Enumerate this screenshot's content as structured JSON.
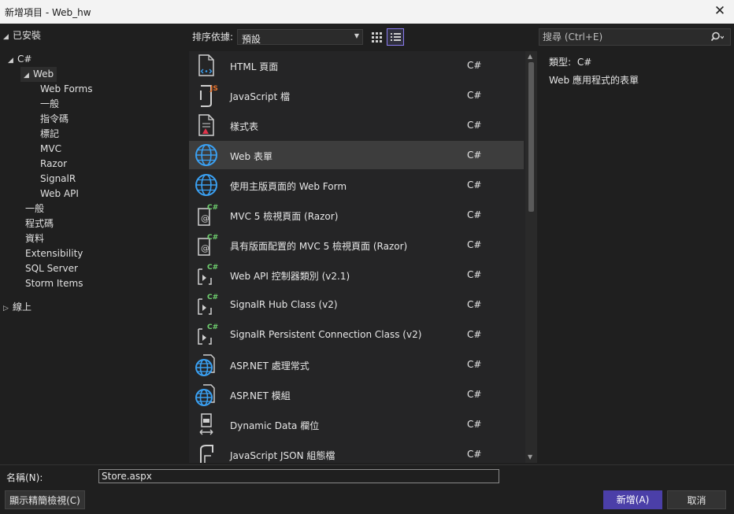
{
  "window": {
    "title": "新增項目 - Web_hw",
    "close_glyph": "✕"
  },
  "tree": {
    "installed": "已安裝",
    "csharp": "C#",
    "web": "Web",
    "web_children": [
      "Web Forms",
      "一般",
      "指令碼",
      "標記",
      "MVC",
      "Razor",
      "SignalR",
      "Web API"
    ],
    "csharp_children": [
      "一般",
      "程式碼",
      "資料",
      "Extensibility",
      "SQL Server",
      "Storm Items"
    ],
    "online": "線上",
    "selected": "Web"
  },
  "toolbar": {
    "sort_label": "排序依據:",
    "sort_value": "預設",
    "view_mode": "list"
  },
  "search": {
    "placeholder": "搜尋 (Ctrl+E)"
  },
  "items": [
    {
      "name": "HTML 頁面",
      "lang": "C#",
      "icon": "html-page-icon"
    },
    {
      "name": "JavaScript 檔",
      "lang": "C#",
      "icon": "javascript-file-icon"
    },
    {
      "name": "樣式表",
      "lang": "C#",
      "icon": "stylesheet-icon"
    },
    {
      "name": "Web 表單",
      "lang": "C#",
      "icon": "web-form-globe-icon"
    },
    {
      "name": "使用主版頁面的 Web Form",
      "lang": "C#",
      "icon": "web-form-globe-icon"
    },
    {
      "name": "MVC 5 檢視頁面 (Razor)",
      "lang": "C#",
      "icon": "razor-view-icon"
    },
    {
      "name": "具有版面配置的 MVC 5 檢視頁面 (Razor)",
      "lang": "C#",
      "icon": "razor-view-icon"
    },
    {
      "name": "Web API 控制器類別 (v2.1)",
      "lang": "C#",
      "icon": "csharp-class-icon"
    },
    {
      "name": "SignalR Hub Class (v2)",
      "lang": "C#",
      "icon": "csharp-class-icon"
    },
    {
      "name": "SignalR Persistent Connection Class (v2)",
      "lang": "C#",
      "icon": "csharp-class-icon"
    },
    {
      "name": "ASP.NET 處理常式",
      "lang": "C#",
      "icon": "aspnet-globe-icon"
    },
    {
      "name": "ASP.NET 模組",
      "lang": "C#",
      "icon": "aspnet-globe-icon"
    },
    {
      "name": "Dynamic Data 欄位",
      "lang": "C#",
      "icon": "dynamic-data-icon"
    },
    {
      "name": "JavaScript JSON 組態檔",
      "lang": "C#",
      "icon": "json-config-icon"
    }
  ],
  "selected_item": "Web 表單",
  "details": {
    "type_label": "類型:",
    "type_value": "C#",
    "description": "Web 應用程式的表單"
  },
  "bottom": {
    "name_label": "名稱(N):",
    "name_value": "Store.aspx",
    "compact_view_button": "顯示精簡檢視(C)",
    "add_button": "新增(A)",
    "cancel_button": "取消"
  },
  "colors": {
    "accent": "#4b3fa8",
    "selection": "#3d3d3d",
    "globe": "#3aa0f2"
  }
}
